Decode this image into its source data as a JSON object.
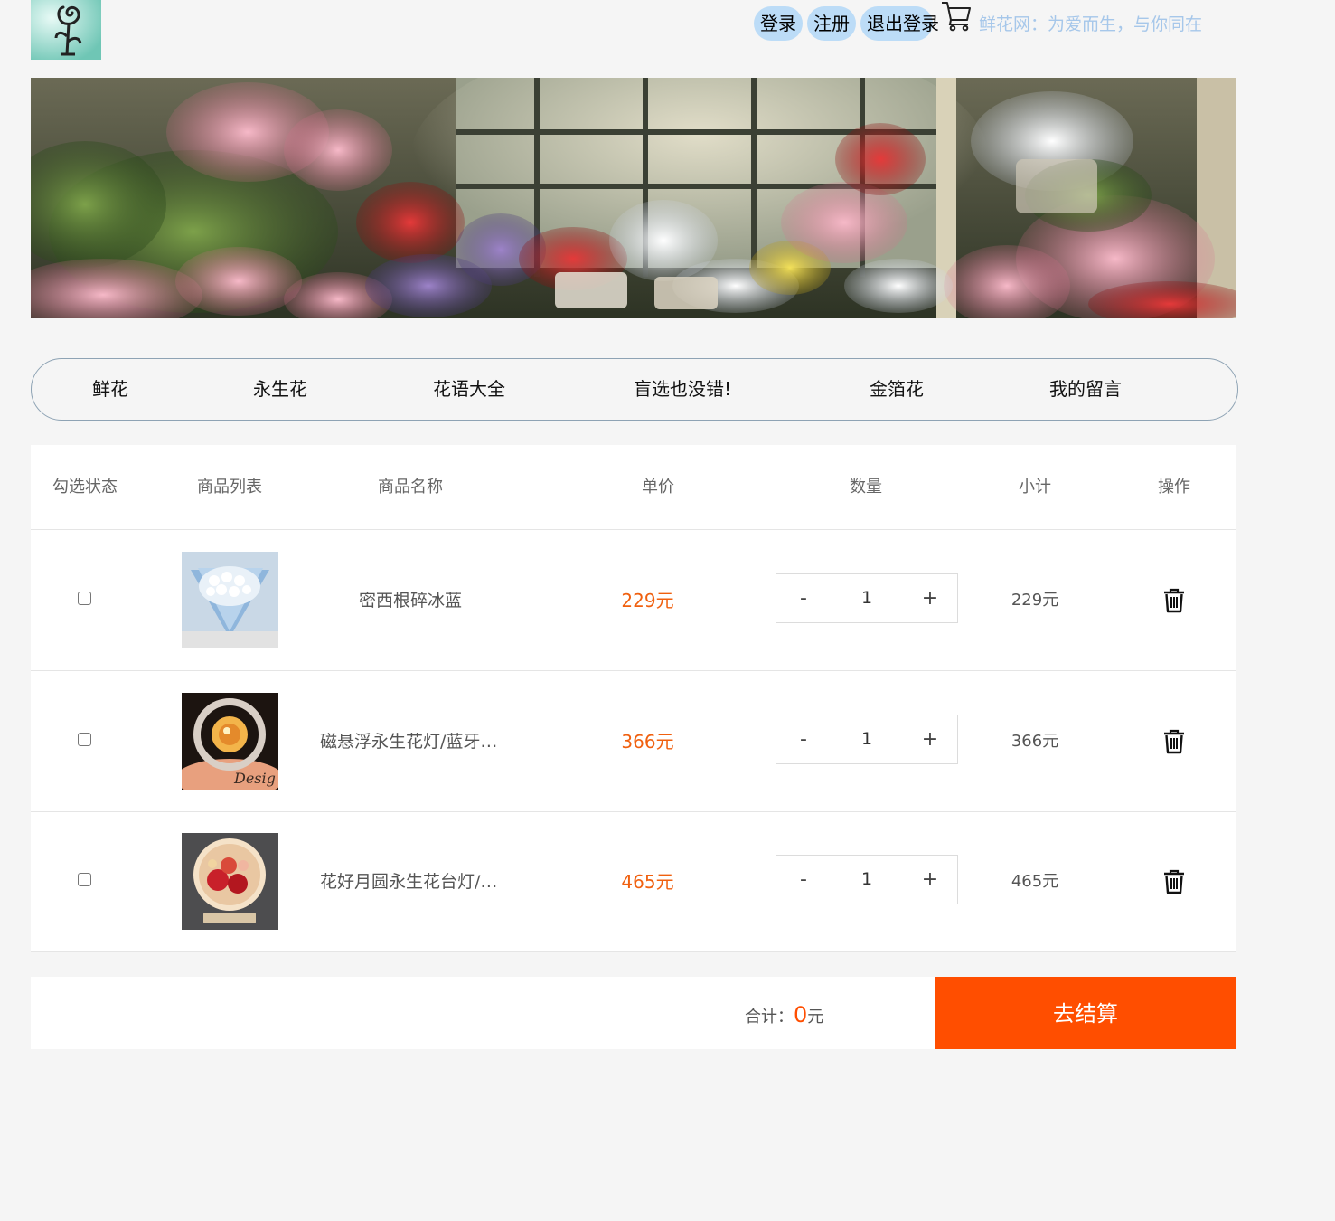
{
  "header": {
    "login_label": "登录",
    "register_label": "注册",
    "logout_label": "退出登录",
    "cart_icon": "cart-icon",
    "slogan": "鲜花网：为爱而生，与你同在"
  },
  "nav": {
    "items": [
      {
        "label": "鲜花"
      },
      {
        "label": "永生花"
      },
      {
        "label": "花语大全"
      },
      {
        "label": "盲选也没错!"
      },
      {
        "label": "金箔花"
      },
      {
        "label": "我的留言"
      }
    ]
  },
  "cart": {
    "columns": [
      "勾选状态",
      "商品列表",
      "商品名称",
      "单价",
      "数量",
      "小计",
      "操作"
    ],
    "rows": [
      {
        "checked": false,
        "name": "密西根碎冰蓝",
        "price": "229元",
        "quantity": "1",
        "subtotal": "229元"
      },
      {
        "checked": false,
        "name": "磁悬浮永生花灯/蓝牙音箱",
        "price": "366元",
        "quantity": "1",
        "subtotal": "366元"
      },
      {
        "checked": false,
        "name": "花好月圆永生花台灯/夜灯",
        "price": "465元",
        "quantity": "1",
        "subtotal": "465元"
      }
    ],
    "stepper": {
      "minus": "-",
      "plus": "+"
    }
  },
  "footer": {
    "total_label": "合计：",
    "total_value": "0",
    "total_unit": "元",
    "checkout_label": "去结算"
  },
  "colors": {
    "accent": "#ff4e00",
    "price": "#f0600f",
    "auth_button_bg": "#bcdcf7",
    "slogan": "#a6c7ea",
    "page_bg": "#f5f5f5"
  }
}
